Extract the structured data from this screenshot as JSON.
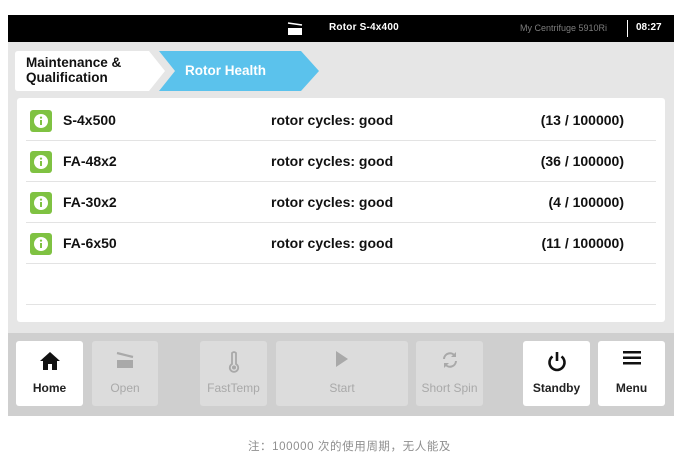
{
  "status_bar": {
    "icon": "lid-icon",
    "title": "Rotor S-4x400",
    "device_name": "My Centrifuge 5910Ri",
    "time": "08:27"
  },
  "breadcrumb": {
    "items": [
      {
        "label": "Maintenance & Qualification",
        "active": false
      },
      {
        "label": "Rotor Health",
        "active": true
      }
    ]
  },
  "rotors": [
    {
      "icon": "info-icon",
      "name": "S-4x500",
      "status": "rotor cycles: good",
      "count": "(13 / 100000)"
    },
    {
      "icon": "info-icon",
      "name": "FA-48x2",
      "status": "rotor cycles: good",
      "count": "(36 / 100000)"
    },
    {
      "icon": "info-icon",
      "name": "FA-30x2",
      "status": "rotor cycles: good",
      "count": "(4 / 100000)"
    },
    {
      "icon": "info-icon",
      "name": "FA-6x50",
      "status": "rotor cycles: good",
      "count": "(11 / 100000)"
    }
  ],
  "toolbar": {
    "home": {
      "label": "Home",
      "icon": "home-icon",
      "enabled": true
    },
    "open": {
      "label": "Open",
      "icon": "lid-open-icon",
      "enabled": false
    },
    "fasttemp": {
      "label": "FastTemp",
      "icon": "thermometer-icon",
      "enabled": false
    },
    "start": {
      "label": "Start",
      "icon": "play-icon",
      "enabled": false
    },
    "shortspin": {
      "label": "Short Spin",
      "icon": "refresh-icon",
      "enabled": false
    },
    "standby": {
      "label": "Standby",
      "icon": "power-icon",
      "enabled": true
    },
    "menu": {
      "label": "Menu",
      "icon": "menu-icon",
      "enabled": true
    }
  },
  "colors": {
    "accent": "#5bc2ec",
    "info_green": "#7fc242",
    "status_bar": "#000000"
  },
  "footnote": "注：100000 次的使用周期，无人能及"
}
